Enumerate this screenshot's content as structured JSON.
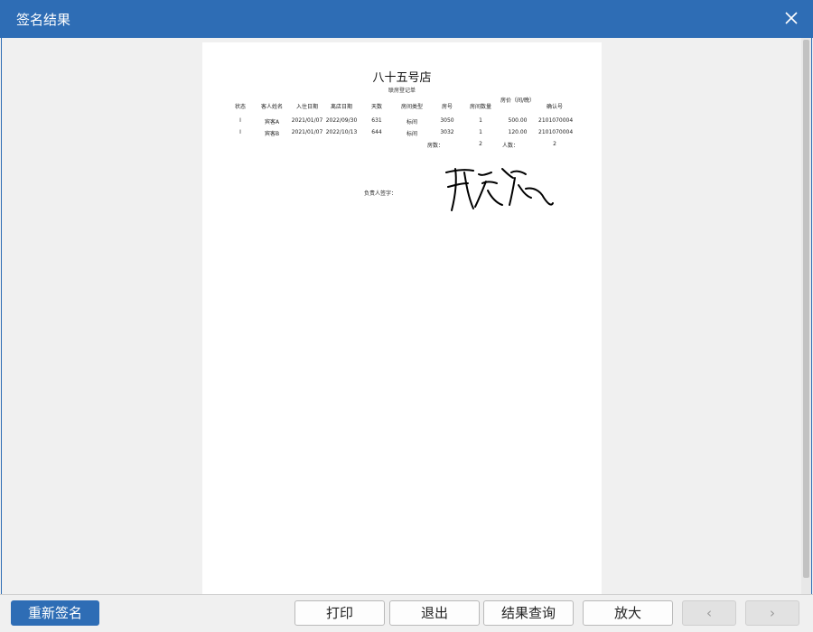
{
  "window": {
    "title": "签名结果"
  },
  "document": {
    "hotel_name": "八十五号店",
    "form_title": "联房登记单",
    "columns": [
      "状态",
      "客人姓名",
      "入住日期",
      "离店日期",
      "天数",
      "房间类型",
      "房号",
      "房间数量",
      "房价（间/晚）",
      "确认号"
    ],
    "rows": [
      [
        "I",
        "宾客A",
        "2021/01/07",
        "2022/09/30",
        "631",
        "标间",
        "3050",
        "1",
        "500.00",
        "2101070004"
      ],
      [
        "I",
        "宾客B",
        "2021/01/07",
        "2022/10/13",
        "644",
        "标间",
        "3032",
        "1",
        "120.00",
        "2101070004"
      ]
    ],
    "summary": {
      "rooms_label": "房数：",
      "rooms_value": "2",
      "people_label": "人数：",
      "people_value": "2"
    },
    "signature_label": "负责人签字："
  },
  "buttons": {
    "resign": "重新签名",
    "print": "打印",
    "exit": "退出",
    "query": "结果查询",
    "zoom": "放大",
    "prev": "‹",
    "next": "›"
  },
  "icons": {
    "close": "close-icon",
    "signature": "handwritten-signature"
  },
  "colors": {
    "accent": "#2e6db5"
  }
}
